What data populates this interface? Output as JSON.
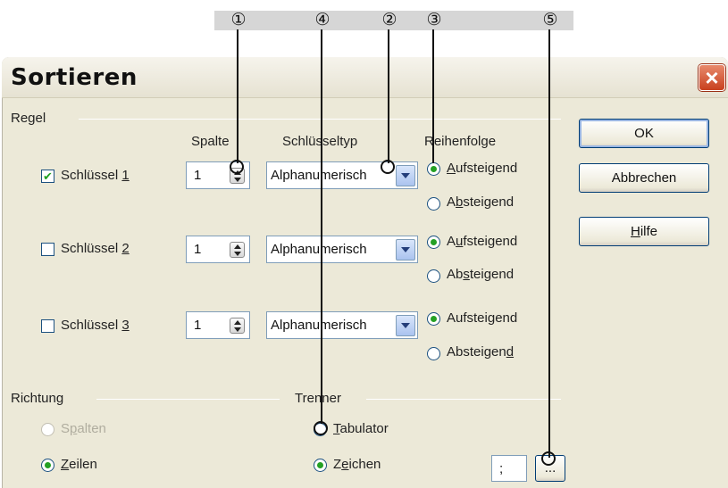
{
  "callouts": [
    "①",
    "④",
    "②",
    "③",
    "⑤"
  ],
  "dialog": {
    "title": "Sortieren",
    "close": "×"
  },
  "rules_group": {
    "label": "Regel",
    "headers": {
      "column": "Spalte",
      "key_type": "Schlüsseltyp",
      "order": "Reihenfolge"
    },
    "keys": [
      {
        "prefix": "Schlüssel ",
        "mnemonic": "1",
        "checked": true,
        "column": "1",
        "type": "Alphanumerisch",
        "asc_pre": "",
        "asc_mn": "A",
        "asc_post": "ufsteigend",
        "desc_pre": "A",
        "desc_mn": "b",
        "desc_post": "steigend",
        "ascending": true
      },
      {
        "prefix": "Schlüssel ",
        "mnemonic": "2",
        "checked": false,
        "column": "1",
        "type": "Alphanumerisch",
        "asc_pre": "A",
        "asc_mn": "u",
        "asc_post": "fsteigend",
        "desc_pre": "Ab",
        "desc_mn": "s",
        "desc_post": "teigend",
        "ascending": true
      },
      {
        "prefix": "Schlüssel ",
        "mnemonic": "3",
        "checked": false,
        "column": "1",
        "type": "Alphanumerisch",
        "asc_pre": "Aufstei",
        "asc_mn": "g",
        "asc_post": "end",
        "desc_pre": "Absteigen",
        "desc_mn": "d",
        "desc_post": "",
        "ascending": true
      }
    ]
  },
  "direction_group": {
    "label": "Richtung",
    "columns": {
      "pre": "S",
      "mn": "p",
      "post": "alten",
      "enabled": false,
      "selected": false
    },
    "rows": {
      "pre": "",
      "mn": "Z",
      "post": "eilen",
      "enabled": true,
      "selected": true
    }
  },
  "separator_group": {
    "label": "Trenner",
    "tab": {
      "pre": "",
      "mn": "T",
      "post": "abulator",
      "selected": false
    },
    "char": {
      "pre": "Z",
      "mn": "e",
      "post": "ichen",
      "selected": true
    },
    "char_value": ";",
    "more_label": "..."
  },
  "buttons": {
    "ok": "OK",
    "cancel": "Abbrechen",
    "help_mn": "H",
    "help_post": "ilfe"
  }
}
